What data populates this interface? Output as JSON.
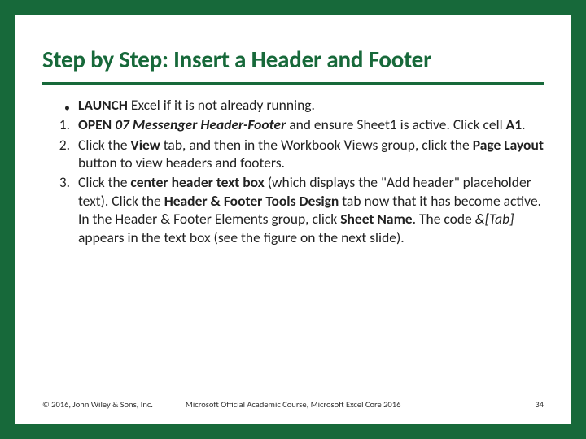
{
  "title": "Step by Step: Insert a Header and Footer",
  "items": {
    "bullet": {
      "marker": "•",
      "parts": [
        {
          "t": "LAUNCH",
          "cls": "b"
        },
        {
          "t": " Excel if it is not already running."
        }
      ]
    },
    "s1": {
      "marker": "1.",
      "parts": [
        {
          "t": "OPEN",
          "cls": "b"
        },
        {
          "t": " "
        },
        {
          "t": "07 Messenger Header-Footer",
          "cls": "bi"
        },
        {
          "t": " and ensure Sheet1 is active. Click cell "
        },
        {
          "t": "A1",
          "cls": "b"
        },
        {
          "t": "."
        }
      ]
    },
    "s2": {
      "marker": "2.",
      "parts": [
        {
          "t": "Click the "
        },
        {
          "t": "View",
          "cls": "b"
        },
        {
          "t": " tab, and then in the Workbook Views group, click the "
        },
        {
          "t": "Page Layout",
          "cls": "b"
        },
        {
          "t": " button to view headers and footers."
        }
      ]
    },
    "s3": {
      "marker": "3.",
      "parts": [
        {
          "t": "Click the "
        },
        {
          "t": "center header text box",
          "cls": "b"
        },
        {
          "t": " (which displays the \"Add header\" placeholder text). Click the "
        },
        {
          "t": "Header & Footer Tools Design",
          "cls": "b"
        },
        {
          "t": " tab now that it has become active. In the Header & Footer Elements group, click "
        },
        {
          "t": "Sheet Name",
          "cls": "b"
        },
        {
          "t": ". The code "
        },
        {
          "t": "&[Tab]",
          "cls": "i"
        },
        {
          "t": " appears in the text box (see the figure on the next slide)."
        }
      ]
    }
  },
  "footer": {
    "copyright": "© 2016, John Wiley & Sons, Inc.",
    "course": "Microsoft Official Academic Course, Microsoft Excel Core 2016",
    "page": "34"
  }
}
